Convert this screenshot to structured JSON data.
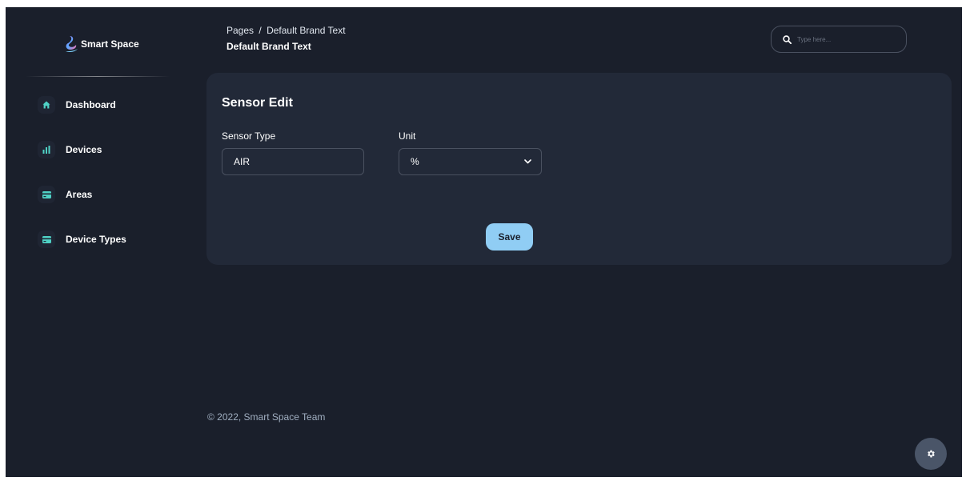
{
  "brand": {
    "name": "Smart Space"
  },
  "sidebar": {
    "items": [
      {
        "label": "Dashboard",
        "icon": "home-icon"
      },
      {
        "label": "Devices",
        "icon": "stats-icon"
      },
      {
        "label": "Areas",
        "icon": "credit-card-icon"
      },
      {
        "label": "Device Types",
        "icon": "credit-card-icon"
      }
    ]
  },
  "header": {
    "breadcrumb_root": "Pages",
    "breadcrumb_separator": "/",
    "breadcrumb_current": "Default Brand Text",
    "title": "Default Brand Text",
    "search_placeholder": "Type here..."
  },
  "form": {
    "title": "Sensor Edit",
    "sensor_type_label": "Sensor Type",
    "sensor_type_value": "AIR",
    "unit_label": "Unit",
    "unit_value": "%",
    "save_label": "Save"
  },
  "footer": {
    "text": "© 2022, Smart Space Team"
  },
  "colors": {
    "background": "#1a1f2b",
    "card": "#222938",
    "accent_teal": "#4fd1c5",
    "save_button": "#90cdf4",
    "settings_fab": "#4a5568"
  }
}
